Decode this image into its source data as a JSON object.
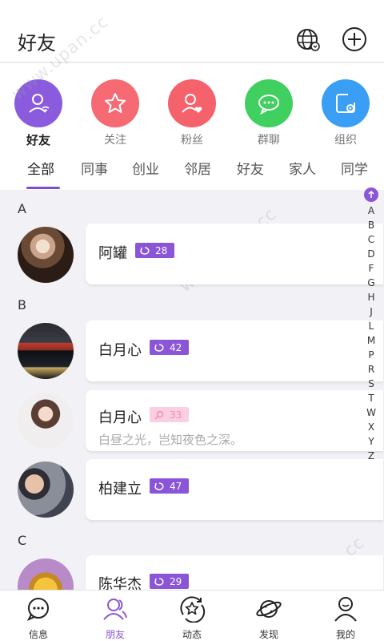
{
  "header": {
    "title": "好友",
    "globe_icon": "globe-refresh-icon",
    "add_icon": "plus-circle-icon"
  },
  "categories": [
    {
      "label": "好友",
      "color": "#8b5bdd",
      "icon": "user-wifi-icon",
      "active": true
    },
    {
      "label": "关注",
      "color": "#f56a73",
      "icon": "star-icon",
      "active": false
    },
    {
      "label": "粉丝",
      "color": "#f5626c",
      "icon": "user-heart-icon",
      "active": false
    },
    {
      "label": "群聊",
      "color": "#3fd05f",
      "icon": "chat-icon",
      "active": false
    },
    {
      "label": "组织",
      "color": "#3a9ef4",
      "icon": "org-settings-icon",
      "active": false
    }
  ],
  "tabs": [
    "全部",
    "同事",
    "创业",
    "邻居",
    "好友",
    "家人",
    "同学"
  ],
  "active_tab": 0,
  "sections": [
    "A",
    "B",
    "C"
  ],
  "contacts": [
    {
      "name": "阿罐",
      "badge": "28",
      "badge_style": "purple",
      "subtitle": ""
    },
    {
      "name": "白月心",
      "badge": "42",
      "badge_style": "purple",
      "subtitle": ""
    },
    {
      "name": "白月心",
      "badge": "33",
      "badge_style": "pink",
      "subtitle": "白昼之光，岂知夜色之深。"
    },
    {
      "name": "柏建立",
      "badge": "47",
      "badge_style": "purple",
      "subtitle": ""
    },
    {
      "name": "陈华杰",
      "badge": "29",
      "badge_style": "purple",
      "subtitle": ""
    }
  ],
  "index_letters": [
    "A",
    "B",
    "C",
    "D",
    "F",
    "G",
    "H",
    "J",
    "L",
    "M",
    "P",
    "R",
    "S",
    "T",
    "W",
    "X",
    "Y",
    "Z"
  ],
  "bottom_nav": [
    {
      "label": "信息",
      "icon": "message-bubble-icon",
      "active": false
    },
    {
      "label": "朋友",
      "icon": "friends-icon",
      "active": true
    },
    {
      "label": "动态",
      "icon": "star-refresh-icon",
      "active": false
    },
    {
      "label": "发现",
      "icon": "planet-icon",
      "active": false
    },
    {
      "label": "我的",
      "icon": "user-icon",
      "active": false
    }
  ],
  "watermark": "www.upan.cc",
  "colors": {
    "accent": "#8a55d6",
    "pink_badge": "#f9cfe1"
  }
}
